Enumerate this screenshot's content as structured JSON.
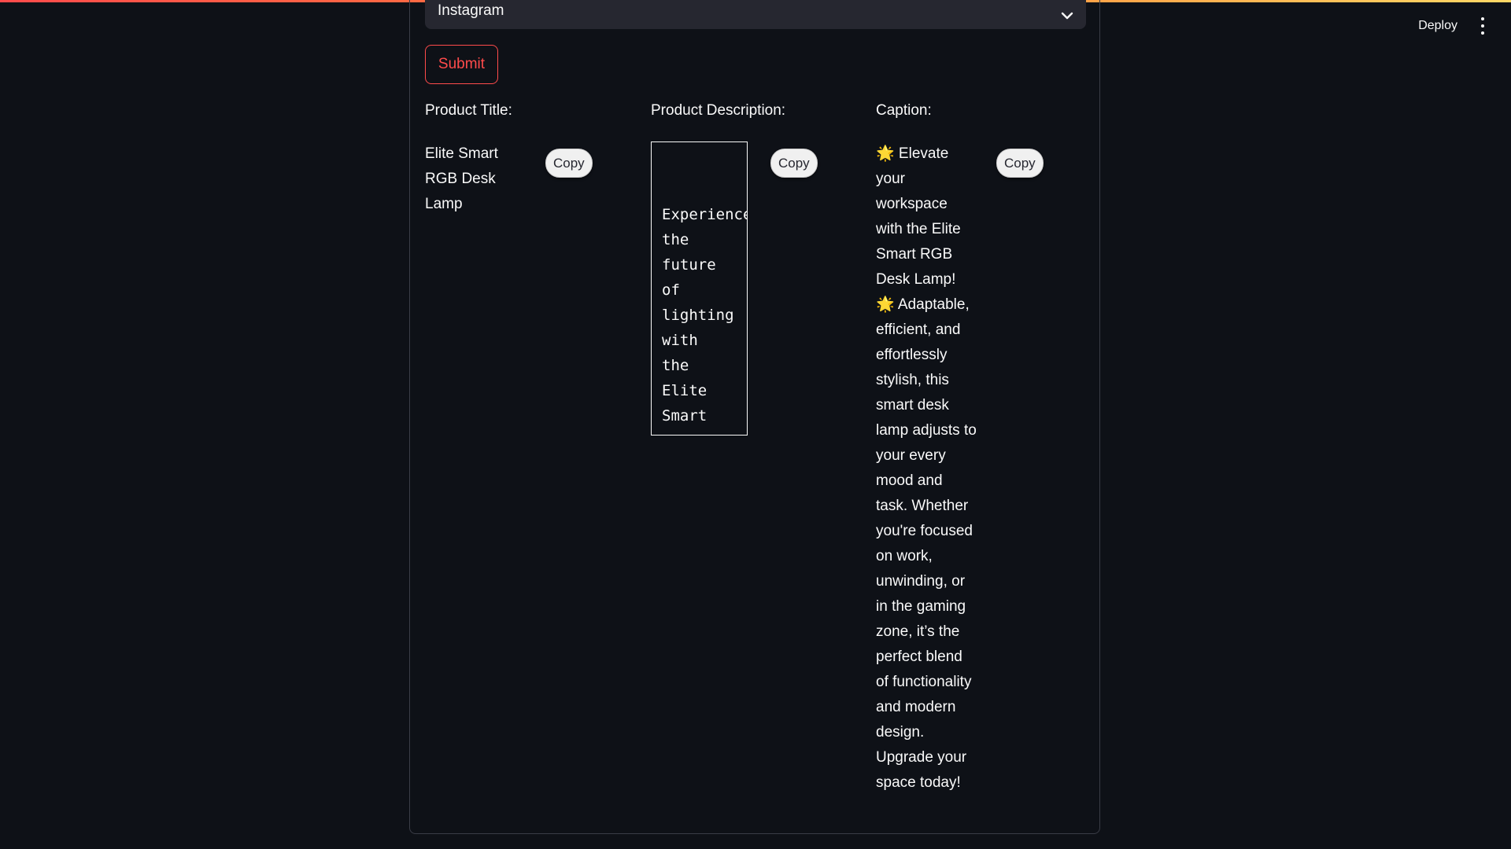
{
  "header": {
    "deploy_label": "Deploy"
  },
  "form": {
    "platform_select_value": "Instagram",
    "submit_label": "Submit"
  },
  "results": {
    "title_label": "Product Title:",
    "description_label": "Product Description:",
    "caption_label": "Caption:",
    "copy_label": "Copy",
    "title_value": "Elite Smart RGB Desk Lamp",
    "description_value": "Experience the future of lighting with the Elite Smart",
    "caption_value": "🌟 Elevate your workspace with the Elite Smart RGB Desk Lamp! 🌟 Adaptable, efficient, and effortlessly stylish, this smart desk lamp adjusts to your every mood and task. Whether you're focused on work, unwinding, or in the gaming zone, it’s the perfect blend of functionality and modern design. Upgrade your space today!"
  },
  "colors": {
    "background": "#0e1117",
    "accent": "#ff4b4b",
    "input_bg": "#262730"
  },
  "icons": {
    "select_chevron": "chevron-down-icon",
    "main_menu": "kebab-menu-icon"
  }
}
